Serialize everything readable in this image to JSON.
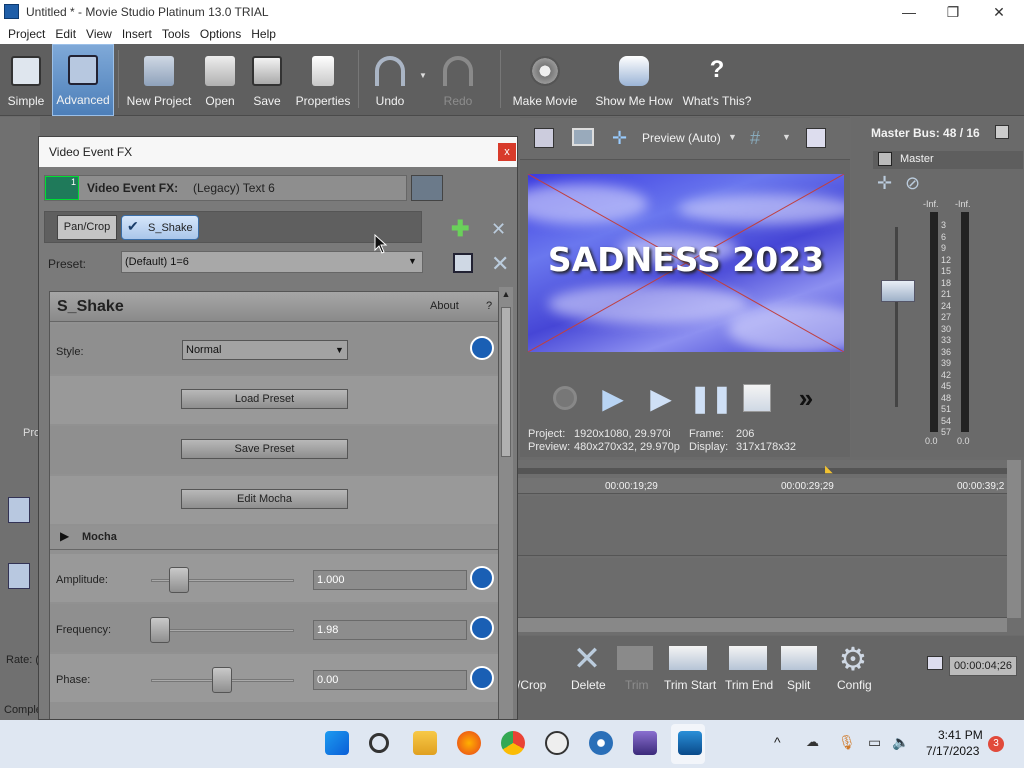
{
  "window": {
    "title": "Untitled * - Movie Studio Platinum 13.0 TRIAL"
  },
  "menu": [
    "Project",
    "Edit",
    "View",
    "Insert",
    "Tools",
    "Options",
    "Help"
  ],
  "toolbar": {
    "simple": "Simple",
    "advanced": "Advanced",
    "new_project": "New Project",
    "open": "Open",
    "save": "Save",
    "properties": "Properties",
    "undo": "Undo",
    "redo": "Redo",
    "make_movie": "Make Movie",
    "show_me_how": "Show Me How",
    "whats_this": "What's This?"
  },
  "dialog": {
    "title": "Video Event FX",
    "close": "x",
    "fx_label": "Video Event FX:",
    "fx_name": "(Legacy) Text 6",
    "fx_badge": "1",
    "chain": [
      "Pan/Crop",
      "S_Shake"
    ],
    "preset_label": "Preset:",
    "preset_value": "(Default) 1=6",
    "plugin_title": "S_Shake",
    "about": "About",
    "help": "?",
    "style_label": "Style:",
    "style_value": "Normal",
    "load_preset": "Load Preset",
    "save_preset": "Save Preset",
    "edit_mocha": "Edit Mocha",
    "mocha": "Mocha",
    "amplitude_label": "Amplitude:",
    "amplitude_value": "1.000",
    "frequency_label": "Frequency:",
    "frequency_value": "1.98",
    "phase_label": "Phase:",
    "phase_value": "0.00"
  },
  "preview": {
    "mode": "Preview (Auto)",
    "overlay_text": "SADNESS 2023",
    "project_label": "Project:",
    "project_value": "1920x1080, 29.970i",
    "preview_label": "Preview:",
    "preview_value": "480x270x32, 29.970p",
    "frame_label": "Frame:",
    "frame_value": "206",
    "display_label": "Display:",
    "display_value": "317x178x32"
  },
  "master": {
    "title": "Master Bus: 48 / 16",
    "label": "Master",
    "inf_left": "-Inf.",
    "inf_right": "-Inf.",
    "scale": [
      "3",
      "6",
      "9",
      "12",
      "15",
      "18",
      "21",
      "24",
      "27",
      "30",
      "33",
      "36",
      "39",
      "42",
      "45",
      "48",
      "51",
      "54",
      "57"
    ],
    "bottom_left": "0.0",
    "bottom_right": "0.0"
  },
  "timeline": {
    "ticks": [
      "00:00:19;29",
      "00:00:29;29",
      "00:00:39;2"
    ],
    "time": "00:00:04;26"
  },
  "edit_tools": {
    "pan_crop": "/Crop",
    "delete": "Delete",
    "trim": "Trim",
    "trim_start": "Trim Start",
    "trim_end": "Trim End",
    "split": "Split",
    "config": "Config"
  },
  "left_panel": {
    "pro": "Pro",
    "rate": "Rate: (",
    "complete": "Comple"
  },
  "taskbar": {
    "time": "3:41 PM",
    "date": "7/17/2023",
    "badge": "3"
  }
}
